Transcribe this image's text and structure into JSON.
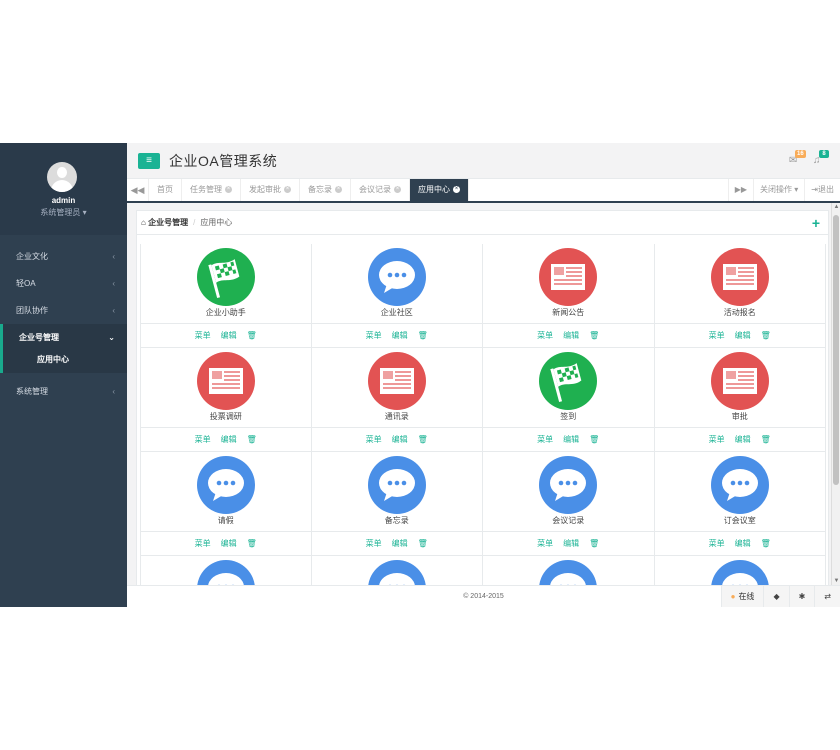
{
  "sidebar": {
    "user_name": "admin",
    "user_role": "系统管理员",
    "items": [
      {
        "label": "企业文化"
      },
      {
        "label": "轻OA"
      },
      {
        "label": "团队协作"
      },
      {
        "label": "企业号管理",
        "sub": "应用中心"
      },
      {
        "label": "系统管理"
      }
    ]
  },
  "header": {
    "title": "企业OA管理系统",
    "mail_count": "16",
    "bell_count": "8",
    "mail_color": "#f8ac59",
    "bell_color": "#1ab394"
  },
  "tabs": {
    "items": [
      "首页",
      "任务管理",
      "发起审批",
      "备忘录",
      "会议记录",
      "应用中心"
    ],
    "active": "应用中心",
    "close_ops": "关闭操作",
    "logout": "退出"
  },
  "breadcrumb": {
    "home": "企业号管理",
    "current": "应用中心"
  },
  "apps": [
    {
      "name": "企业小助手",
      "icon": "flag-icon",
      "color": "#1fb050"
    },
    {
      "name": "企业社区",
      "icon": "chat-bubble-icon",
      "color": "#4a8fe7"
    },
    {
      "name": "新闻公告",
      "icon": "news-icon",
      "color": "#e25353"
    },
    {
      "name": "活动报名",
      "icon": "news-icon",
      "color": "#e25353"
    },
    {
      "name": "投票调研",
      "icon": "news-icon",
      "color": "#e25353"
    },
    {
      "name": "通讯录",
      "icon": "news-icon",
      "color": "#e25353"
    },
    {
      "name": "签到",
      "icon": "flag-icon",
      "color": "#1fb050"
    },
    {
      "name": "审批",
      "icon": "news-icon",
      "color": "#e25353"
    },
    {
      "name": "请假",
      "icon": "chat-bubble-icon",
      "color": "#4a8fe7"
    },
    {
      "name": "备忘录",
      "icon": "chat-bubble-icon",
      "color": "#4a8fe7"
    },
    {
      "name": "会议记录",
      "icon": "chat-bubble-icon",
      "color": "#4a8fe7"
    },
    {
      "name": "订会议室",
      "icon": "chat-bubble-icon",
      "color": "#4a8fe7"
    },
    {
      "name": "",
      "icon": "chat-bubble-icon",
      "color": "#4a8fe7"
    },
    {
      "name": "",
      "icon": "chat-bubble-icon",
      "color": "#4a8fe7"
    },
    {
      "name": "",
      "icon": "chat-bubble-icon",
      "color": "#4a8fe7"
    },
    {
      "name": "",
      "icon": "chat-bubble-icon",
      "color": "#4a8fe7"
    }
  ],
  "actions": {
    "menu": "菜单",
    "edit": "编辑"
  },
  "footer": {
    "copyright": "© 2014-2015",
    "status": "在线"
  }
}
